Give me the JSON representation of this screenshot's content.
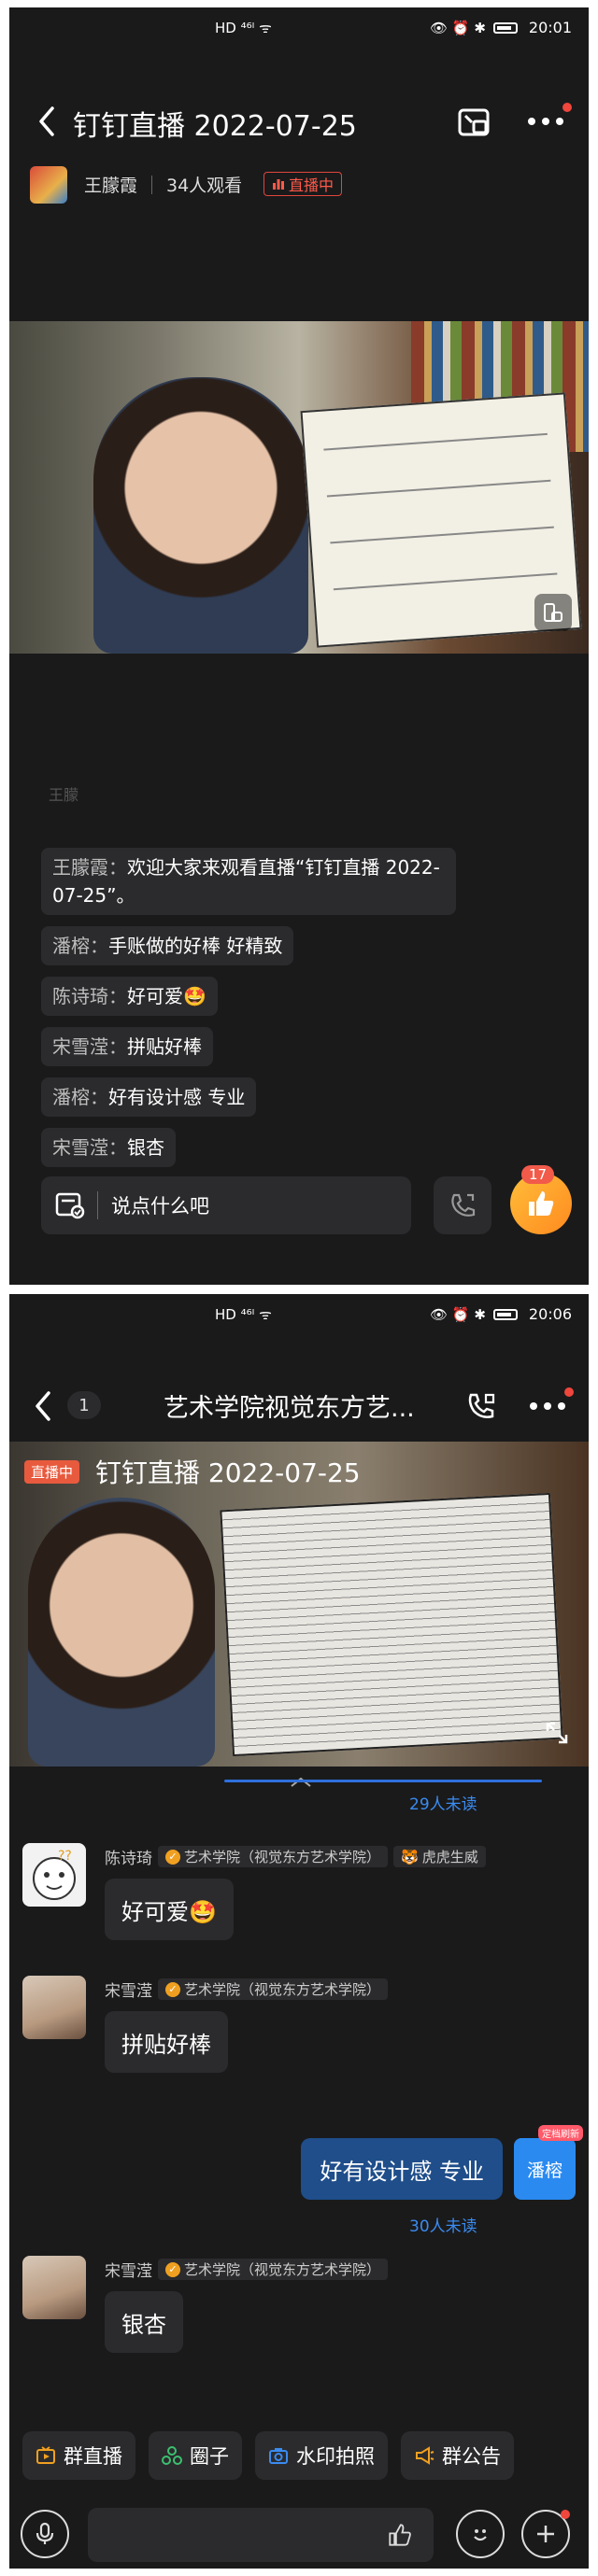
{
  "screen1": {
    "status": {
      "left_icons": "HD ⁴⁶ᴵ ᯤ",
      "right_icons": "👁 ⏰ ✱",
      "time": "20:01"
    },
    "header": {
      "title": "钉钉直播 2022-07-25"
    },
    "host": {
      "name": "王朦霞",
      "viewers": "34人观看",
      "live_label": "直播中"
    },
    "chat_faded": "王朦",
    "chat": [
      {
        "name": "王朦霞：",
        "text": "欢迎大家来观看直播“钉钉直播 2022-07-25”。"
      },
      {
        "name": "潘榕：",
        "text": "手账做的好棒 好精致"
      },
      {
        "name": "陈诗琦：",
        "text": "好可爱🤩"
      },
      {
        "name": "宋雪滢：",
        "text": "拼贴好棒"
      },
      {
        "name": "潘榕：",
        "text": "好有设计感 专业"
      },
      {
        "name": "宋雪滢：",
        "text": "银杏"
      }
    ],
    "input_placeholder": "说点什么吧",
    "like_count": "17"
  },
  "screen2": {
    "status": {
      "left_icons": "HD ⁴⁶ᴵ ᯤ",
      "right_icons": "👁 ⏰ ✱",
      "time": "20:06"
    },
    "header": {
      "back_count": "1",
      "title": "艺术学院视觉东方艺..."
    },
    "video": {
      "live_label": "直播中",
      "title": "钉钉直播 2022-07-25"
    },
    "unread_top": "29人未读",
    "messages": [
      {
        "name": "陈诗琦",
        "org": "艺术学院（视觉东方艺术学院）",
        "extra": "虎虎生威",
        "text": "好可爱🤩"
      },
      {
        "name": "宋雪滢",
        "org": "艺术学院（视觉东方艺术学院）",
        "extra": "",
        "text": "拼贴好棒"
      },
      {
        "name": "宋雪滢",
        "org": "艺术学院（视觉东方艺术学院）",
        "extra": "",
        "text": "银杏"
      }
    ],
    "my_message": "好有设计感 专业",
    "my_avatar": "潘榕",
    "my_avatar_tag": "定档刷新",
    "unread_my": "30人未读",
    "toolbar": [
      "群直播",
      "圈子",
      "水印拍照",
      "群公告"
    ],
    "colors": {
      "accent_blue": "#3a8bf0",
      "live_red": "#e85a3e",
      "bg": "#1a1a1b"
    }
  }
}
